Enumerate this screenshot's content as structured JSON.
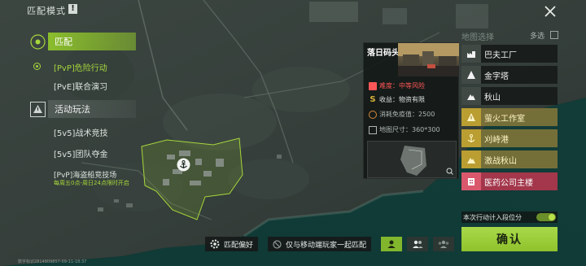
{
  "header": {
    "title": "匹配模式",
    "info_icon": "info-icon",
    "close_icon": "close-icon"
  },
  "modes": {
    "category_match": {
      "label": "匹配",
      "icon": "crosshair-icon"
    },
    "items": [
      {
        "label": "[PvP]危险行动",
        "selected": true
      },
      {
        "label": "[PvE]联合演习",
        "selected": false
      }
    ],
    "category_event": {
      "label": "活动玩法",
      "icon": "warning-icon"
    },
    "event_items": [
      {
        "label": "[5v5]战术竞技"
      },
      {
        "label": "[5v5]团队夺金"
      },
      {
        "label": "[PvP]海盗船竞技场"
      }
    ],
    "event_schedule": "每周五0点-周日24点限时开启"
  },
  "map_card": {
    "title": "落日码头",
    "difficulty_label": "难度：中等风险",
    "income_label": "收益：物资有限",
    "cost_label": "消耗免疫值：2500",
    "size_label": "地图尺寸：360*300"
  },
  "map_select": {
    "title": "地图选择",
    "multi_label": "多选",
    "items": [
      {
        "label": "巴夫工厂",
        "style": "normal",
        "icon": "factory-icon"
      },
      {
        "label": "金字塔",
        "style": "normal",
        "icon": "pyramid-icon"
      },
      {
        "label": "秋山",
        "style": "normal",
        "icon": "mountain-icon"
      },
      {
        "label": "萤火工作室",
        "style": "gold",
        "icon": "warning-icon"
      },
      {
        "label": "刈峙港",
        "style": "gold",
        "icon": "anchor-icon"
      },
      {
        "label": "激战秋山",
        "style": "gold",
        "icon": "mountain-icon"
      },
      {
        "label": "医药公司主楼",
        "style": "red",
        "icon": "building-icon"
      }
    ]
  },
  "controls": {
    "ranked_label": "本次行动计入段位分",
    "ranked_on": true,
    "confirm_label": "确认",
    "prefs_label": "匹配偏好",
    "mobile_label": "仅与移动端玩家一起匹配"
  },
  "footer": {
    "id_text": "数字标识2814809857-09-11-18:37"
  },
  "colors": {
    "accent": "#8fc22c",
    "gold": "#c0a032",
    "red": "#d0506a"
  }
}
